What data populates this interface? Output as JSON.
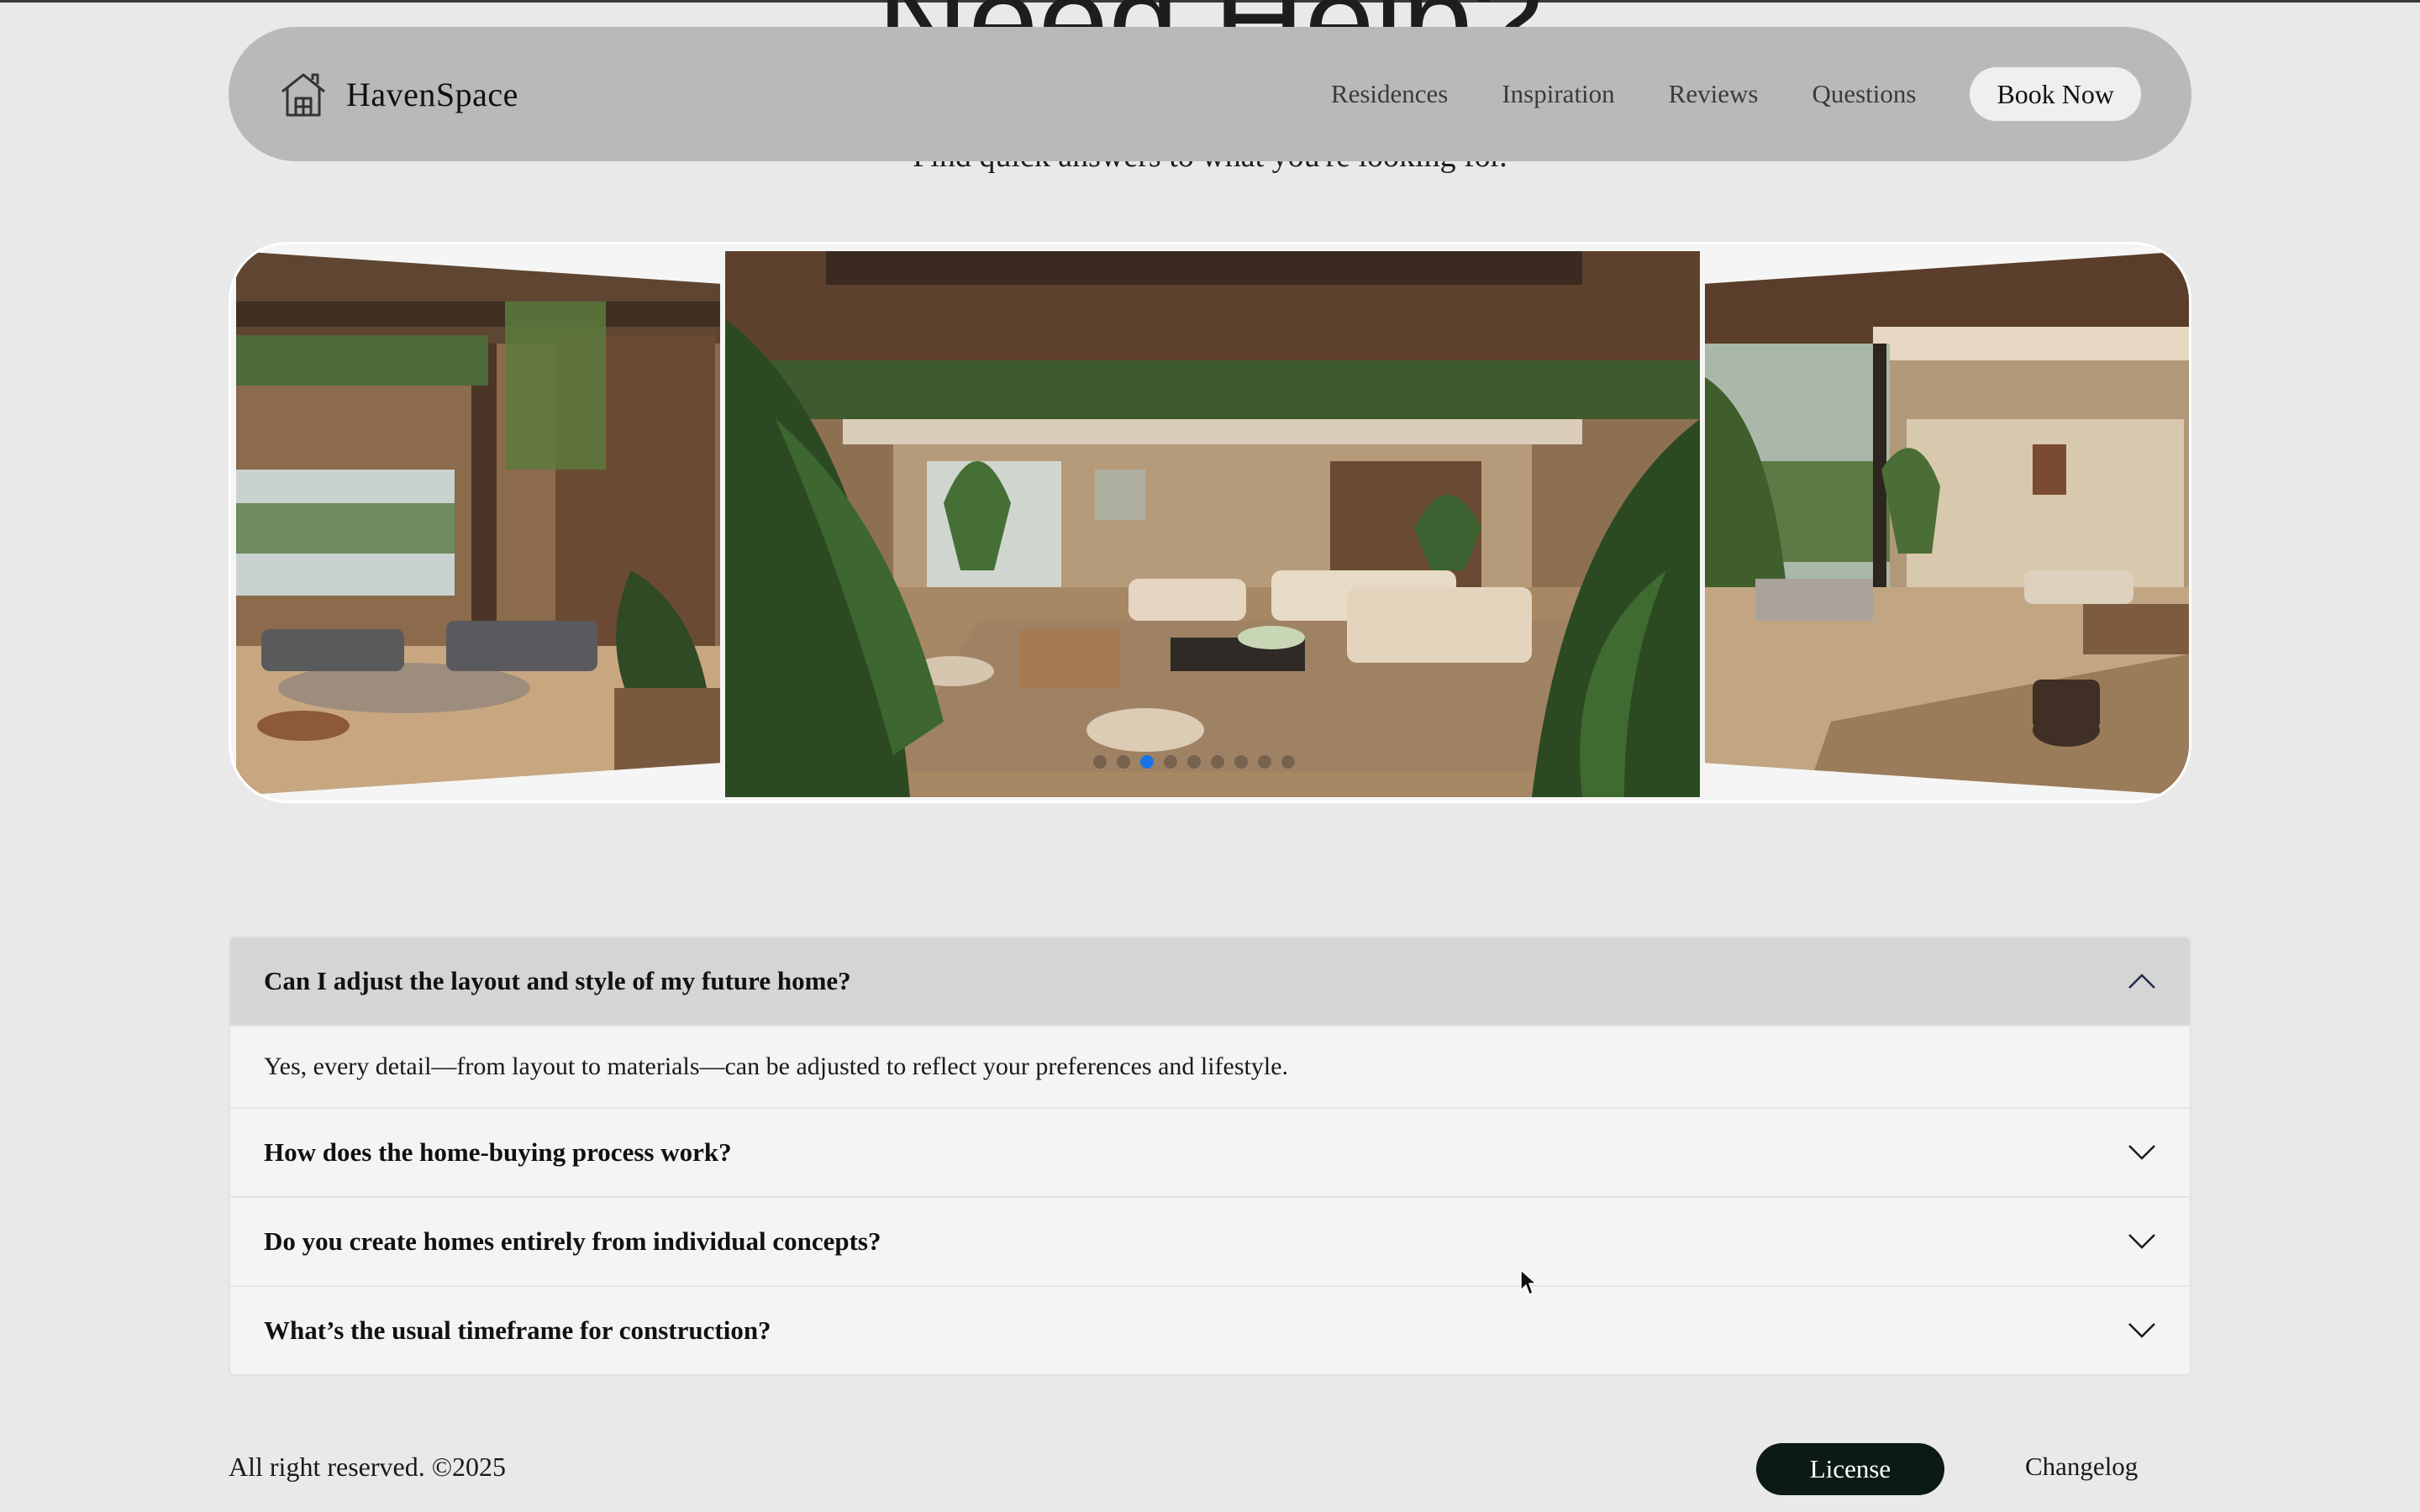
{
  "section": {
    "heading": "Need Help?",
    "subheading": "Find quick answers to what you're looking for."
  },
  "nav": {
    "brand": "HavenSpace",
    "links": [
      "Residences",
      "Inspiration",
      "Reviews",
      "Questions"
    ],
    "cta": "Book Now"
  },
  "gallery": {
    "slide_count": 9,
    "active_index": 2
  },
  "faq": {
    "items": [
      {
        "question": "Can I adjust the layout and style of my future home?",
        "answer": "Yes, every detail—from layout to materials—can be adjusted to reflect your preferences and lifestyle.",
        "open": true
      },
      {
        "question": "How does the home-buying process work?",
        "open": false
      },
      {
        "question": "Do you create homes entirely from individual concepts?",
        "open": false
      },
      {
        "question": "What’s the usual timeframe for construction?",
        "open": false
      }
    ]
  },
  "footer": {
    "copyright": "All right reserved. ©2025",
    "license": "License",
    "changelog": "Changelog"
  },
  "colors": {
    "nav_bg": "#b9b9b9",
    "page_bg": "#e9e9e9",
    "license_bg": "#0c1a14",
    "dot_active": "#1a73e8"
  }
}
